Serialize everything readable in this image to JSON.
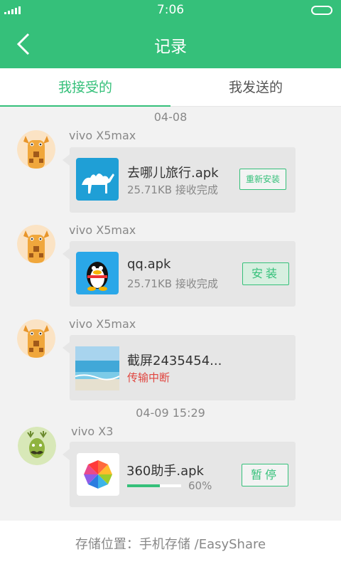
{
  "status_bar": {
    "time": "7:06"
  },
  "header": {
    "title": "记录"
  },
  "tabs": [
    {
      "label": "我接受的",
      "active": true
    },
    {
      "label": "我发送的",
      "active": false
    }
  ],
  "groups": [
    {
      "date": "04-08",
      "items": [
        {
          "sender": "vivo X5max",
          "avatar": "giraffe-avatar",
          "icon": "camel-app-icon",
          "name": "去哪儿旅行.apk",
          "status": "25.71KB 接收完成",
          "action": "重新安装"
        },
        {
          "sender": "vivo X5max",
          "avatar": "giraffe-avatar",
          "icon": "penguin-app-icon",
          "name": "qq.apk",
          "status": "25.71KB 接收完成",
          "action": "安装"
        },
        {
          "sender": "vivo X5max",
          "avatar": "giraffe-avatar",
          "icon": "beach-image-thumbnail",
          "name": "截屏2435454...",
          "status": "传输中断"
        }
      ]
    },
    {
      "date": "04-09 15:29",
      "items": [
        {
          "sender": "vivo X3",
          "avatar": "deer-avatar",
          "icon": "360-app-icon",
          "name": "360助手.apk",
          "progress": 0.6,
          "progress_label": "60%",
          "action": "暂停"
        }
      ]
    }
  ],
  "footer": {
    "label": "存储位置：手机存储 /EasyShare"
  },
  "colors": {
    "accent": "#35c07a",
    "error": "#e0443e",
    "bubble": "#e6e6e6"
  }
}
